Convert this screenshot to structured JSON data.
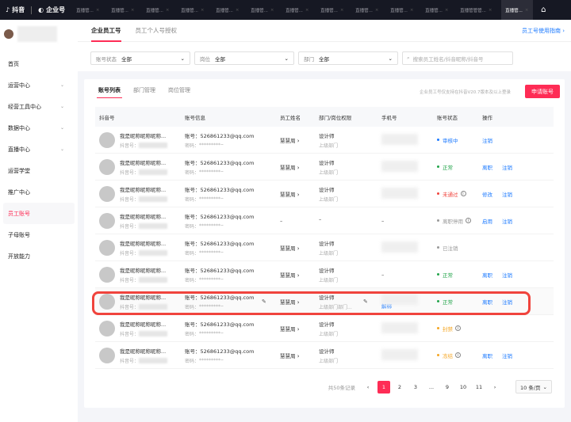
{
  "app": {
    "brand": "抖音",
    "product": "企业号"
  },
  "browser_tabs": [
    "直播管...",
    "直播管...",
    "直播管...",
    "直播管...",
    "直播管...",
    "直播管...",
    "直播管...",
    "直播管...",
    "直播管...",
    "直播管...",
    "直播管...",
    "直播管管管...",
    "直播管..."
  ],
  "active_tab_index": 12,
  "sidebar": {
    "items": [
      {
        "label": "首页"
      },
      {
        "label": "运营中心",
        "chevron": true
      },
      {
        "label": "经营工具中心",
        "chevron": true
      },
      {
        "label": "数据中心",
        "chevron": true
      },
      {
        "label": "直播中心",
        "chevron": true
      },
      {
        "label": "运营学堂"
      },
      {
        "label": "推广中心"
      },
      {
        "label": "员工账号",
        "active": true
      },
      {
        "label": "子母账号"
      },
      {
        "label": "开放能力"
      }
    ]
  },
  "header": {
    "tabs": [
      "企业员工号",
      "员工个人号授权"
    ],
    "guide": "员工号使用指南 ›"
  },
  "filters": {
    "status_label": "账号状态",
    "status_value": "全部",
    "position_label": "岗位",
    "position_value": "全部",
    "dept_label": "部门",
    "dept_value": "全部",
    "search_placeholder": "搜索员工姓名/抖音昵称/抖音号"
  },
  "card": {
    "tabs": [
      "账号列表",
      "部门管理",
      "岗位管理"
    ],
    "note": "企业员工号仅支持在抖音V20.7版本及以上登录",
    "apply_label": "申请账号"
  },
  "table": {
    "columns": [
      "抖音号",
      "账号信息",
      "员工姓名",
      "部门/岗位权限",
      "手机号",
      "账号状态",
      "操作"
    ],
    "account_prefix": "账号：",
    "password_prefix": "密码：",
    "douyin_prefix": "抖音号：",
    "rows": [
      {
        "nick": "我是昵称昵称昵称...",
        "account": "526861233@qq.com",
        "password": "*********",
        "name": "慧慧周",
        "position": "设计师",
        "dept": "上级部门",
        "status": "审核中",
        "status_color": "#1e7bff",
        "actions": [
          "注销"
        ]
      },
      {
        "nick": "我是昵称昵称昵称...",
        "account": "526861233@qq.com",
        "password": "*********",
        "name": "慧慧周",
        "position": "设计师",
        "dept": "上级部门",
        "status": "正常",
        "status_color": "#22a44a",
        "actions": [
          "离职",
          "注销"
        ]
      },
      {
        "nick": "我是昵称昵称昵称...",
        "account": "526861233@qq.com",
        "password": "*********",
        "name": "慧慧周",
        "position": "设计师",
        "dept": "上级部门",
        "status": "未通过",
        "status_color": "#f0443d",
        "info": true,
        "actions": [
          "修改",
          "注销"
        ]
      },
      {
        "nick": "我是昵称昵称昵称...",
        "account": "526861233@qq.com",
        "password": "*********",
        "name": "–",
        "position": "–",
        "dept": "",
        "phone": "–",
        "status": "离职停用",
        "status_color": "#999999",
        "info": true,
        "actions": [
          "启用",
          "注销"
        ]
      },
      {
        "nick": "我是昵称昵称昵称...",
        "account": "526861233@qq.com",
        "password": "*********",
        "name": "慧慧周",
        "position": "设计师",
        "dept": "上级部门",
        "status": "已注销",
        "status_color": "#999999",
        "actions": []
      },
      {
        "nick": "我是昵称昵称昵称...",
        "account": "526861233@qq.com",
        "password": "*********",
        "name": "慧慧周",
        "position": "设计师",
        "dept": "上级部门",
        "phone": "–",
        "status": "正常",
        "status_color": "#22a44a",
        "actions": [
          "离职",
          "注销"
        ]
      },
      {
        "nick": "我是昵称昵称昵称...",
        "account": "526861233@qq.com",
        "password": "*********",
        "name": "慧慧周",
        "position": "设计师",
        "dept": "上级部门部门...",
        "phone_action": "解绑",
        "editable": true,
        "highlighted": true,
        "status": "正常",
        "status_color": "#22a44a",
        "actions": [
          "离职",
          "注销"
        ]
      },
      {
        "nick": "我是昵称昵称昵称...",
        "account": "526861233@qq.com",
        "password": "*********",
        "name": "慧慧周",
        "position": "设计师",
        "dept": "上级部门",
        "status": "封禁",
        "status_color": "#f5a623",
        "info": true,
        "actions": []
      },
      {
        "nick": "我是昵称昵称昵称...",
        "account": "526861233@qq.com",
        "password": "*********",
        "name": "慧慧周",
        "position": "设计师",
        "dept": "上级部门",
        "status": "冻结",
        "status_color": "#f5a623",
        "info": true,
        "actions": [
          "离职",
          "注销"
        ]
      }
    ]
  },
  "pagination": {
    "total": "共50条记录",
    "pages": [
      "1",
      "2",
      "3",
      "...",
      "9",
      "10",
      "11"
    ],
    "current": "1",
    "page_size": "10 条/页"
  }
}
